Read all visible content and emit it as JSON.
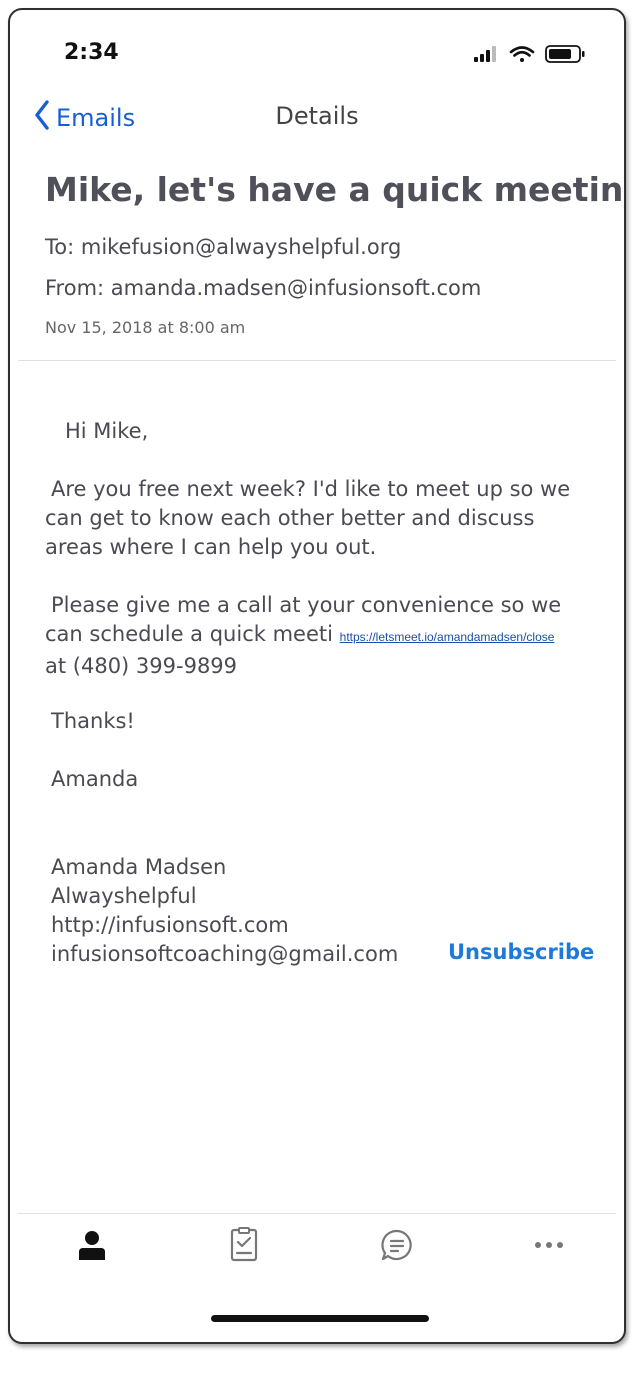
{
  "status_bar": {
    "time": "2:34",
    "icons": [
      "cellular-signal-icon",
      "wifi-icon",
      "battery-icon"
    ]
  },
  "nav": {
    "back_label": "Emails",
    "title": "Details"
  },
  "email": {
    "subject": "Mike, let's have a quick meeting!",
    "to": "To: mikefusion@alwayshelpful.org",
    "from": "From: amanda.madsen@infusionsoft.com",
    "date": "Nov 15, 2018 at 8:00 am",
    "greeting": "Hi Mike,",
    "para1_line1": "Are you free next week? I'd like to meet up so we",
    "para1_line2": "can get to know each other better and discuss",
    "para1_line3": "areas where I can help you out.",
    "para2_line1": "Please give me a call at your convenience so we",
    "para2_line2_prefix": "can schedule a quick meeti",
    "link": "https://letsmeet.io/amandamadsen/close",
    "para2_line3": "at (480) 399-9899",
    "thanks": "Thanks!",
    "signoff": "Amanda",
    "signature": {
      "name": "Amanda Madsen",
      "company": "Alwayshelpful",
      "website": "http://infusionsoft.com",
      "email": "infusionsoftcoaching@gmail.com"
    },
    "unsubscribe_label": "Unsubscribe"
  },
  "tab_bar": {
    "tabs": [
      "person-icon",
      "checklist-icon",
      "chat-bubble-icon",
      "more-icon"
    ]
  },
  "colors": {
    "accent": "#1a5fd1",
    "unsubscribe": "#1e7ad8",
    "text": "#4a4a52"
  }
}
